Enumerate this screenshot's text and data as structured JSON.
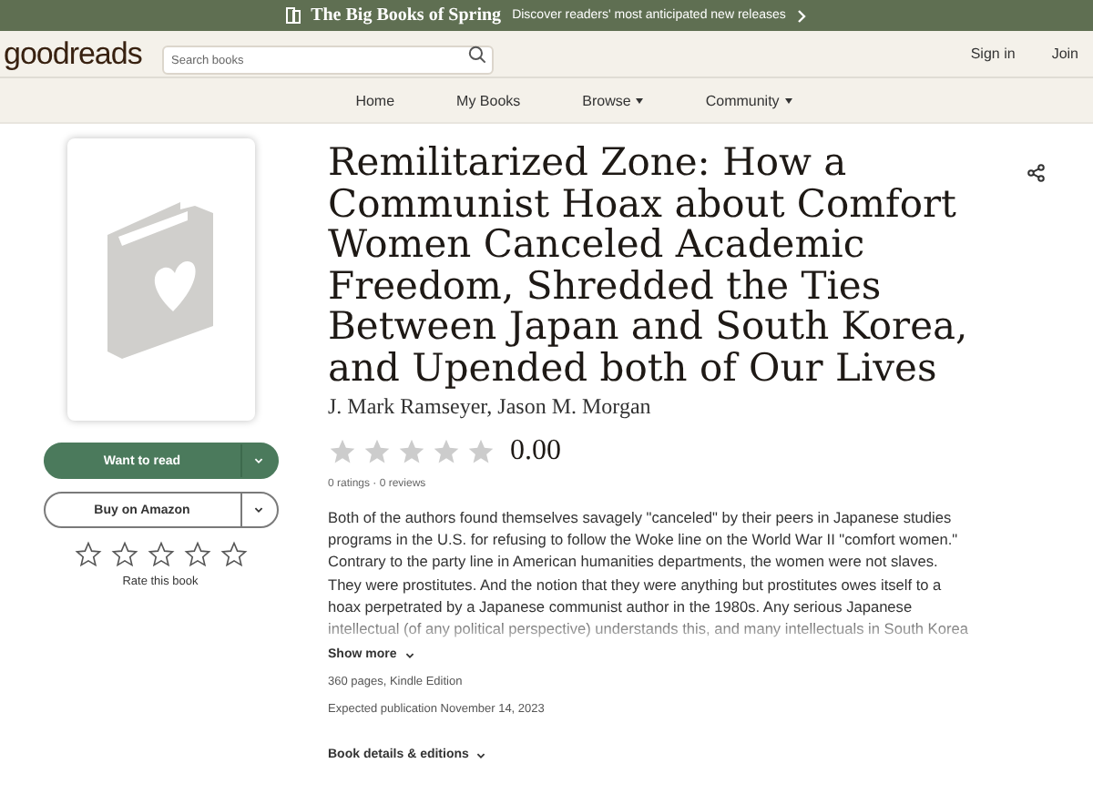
{
  "banner": {
    "title": "The Big Books of Spring",
    "text": "Discover readers' most anticipated new releases"
  },
  "header": {
    "logo": "goodreads",
    "search": {
      "placeholder": "Search books"
    },
    "links": [
      "Sign in",
      "Join"
    ]
  },
  "nav": [
    {
      "label": "Home",
      "dropdown": false
    },
    {
      "label": "My Books",
      "dropdown": false
    },
    {
      "label": "Browse",
      "dropdown": true
    },
    {
      "label": "Community",
      "dropdown": true
    }
  ],
  "actions": {
    "want": "Want to read",
    "buy": "Buy on Amazon",
    "rate": {
      "stars": 0,
      "label": "Rate this book"
    }
  },
  "book": {
    "title": "Remilitarized Zone: How a Communist Hoax about Comfort Women Canceled Academic Freedom, Shredded the Ties Between Japan and South Korea, and Upended both of Our Lives",
    "authors": "J. Mark Ramseyer, Jason M. Morgan",
    "stars": 0,
    "rating": "0.00",
    "counts": "0 ratings · 0 reviews",
    "description": "Both of the authors found themselves savagely \"canceled\" by their peers in Japanese studies programs in the U.S. for refusing to follow the Woke line on the World War II \"comfort women.\"  Contrary to the party line in American humanities departments, the women were not slaves.  They were prostitutes.  And the notion that they were anything but prostitutes owes itself to a hoax perpetrated by a Japanese communist author in the 1980s.  Any serious Japanese intellectual (of any political perspective) understands this, and many intellectuals in South Korea",
    "show_more": "Show more",
    "format": "360 pages, Kindle Edition",
    "published": "Expected publication November 14, 2023",
    "details": "Book details & editions"
  }
}
